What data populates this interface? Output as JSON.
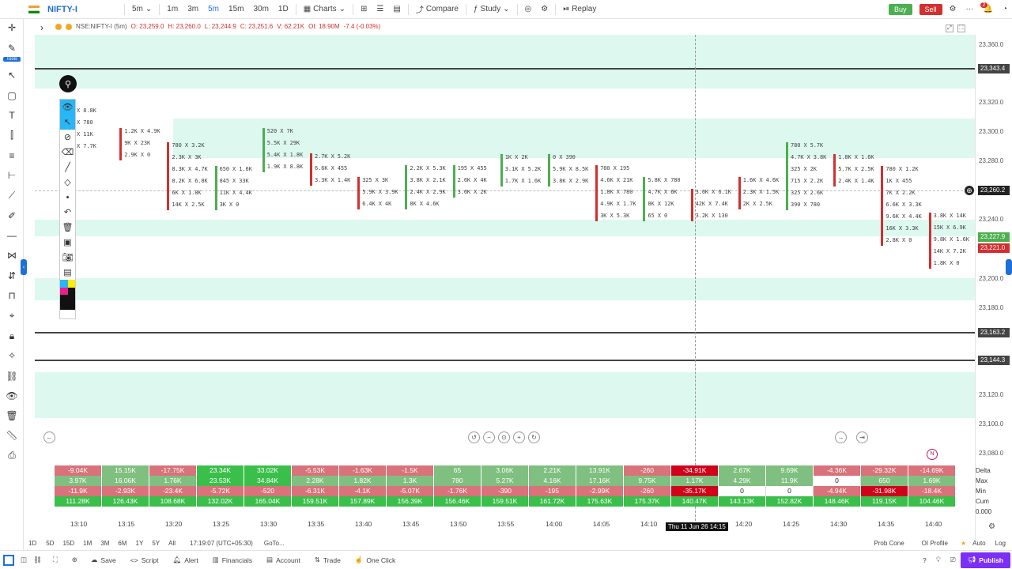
{
  "topbar": {
    "symbol": "NIFTY-I",
    "interval": "5m",
    "quick_intervals": [
      "1m",
      "3m",
      "5m",
      "15m",
      "30m",
      "1D"
    ],
    "active_interval": "5m",
    "charts_label": "Charts",
    "compare_label": "Compare",
    "study_label": "Study",
    "replay_label": "Replay",
    "buy_label": "Buy",
    "sell_label": "Sell",
    "notification_count": "2"
  },
  "left_toolbar": {
    "tools_label": "Tools",
    "icons": [
      "crosshair-icon",
      "pen-icon",
      "pointer-icon",
      "rectangle-icon",
      "text-icon",
      "fib-icon",
      "lines-icon",
      "hline-icon",
      "trendline-icon",
      "brush-icon",
      "ray-icon",
      "pattern-icon",
      "measure-icon",
      "zoom-icon",
      "magnet-icon",
      "lock-icon",
      "link-icon",
      "eye-icon",
      "trash-icon",
      "ruler-icon",
      "camera-icon"
    ]
  },
  "legend": {
    "symbol": "NSE:NIFTY-I (5m)",
    "o": "O: 23,259.0",
    "h": "H: 23,260.0",
    "l": "L: 23,244.9",
    "c": "C: 23,251.6",
    "v": "V: 62.21K",
    "oi": "OI: 18.90M",
    "chg": "-7.4  (-0.03%)"
  },
  "yaxis": {
    "labels": [
      "23,360.0",
      "23,320.0",
      "23,300.0",
      "23,280.0",
      "23,240.0",
      "23,200.0",
      "23,180.0",
      "23,120.0",
      "23,100.0",
      "23,080.0"
    ],
    "flags": [
      {
        "value": "23,343.4",
        "color": "#444444"
      },
      {
        "value": "23,260.2",
        "color": "#222222"
      },
      {
        "value": "23,227.9",
        "color": "#4caf50"
      },
      {
        "value": "23,221.0",
        "color": "#d32f2f"
      },
      {
        "value": "23,163.2",
        "color": "#444444"
      },
      {
        "value": "23,144.3",
        "color": "#444444"
      }
    ]
  },
  "footprint_columns": [
    {
      "time": "13:10",
      "rows": [
        "X 8.8K",
        "X 780",
        "X 11K",
        "X 7.7K"
      ]
    },
    {
      "time": "13:15",
      "rows": [
        "1.2K X 4.9K",
        "9K X 23K",
        "2.9K X 0"
      ]
    },
    {
      "time": "13:20",
      "rows": [
        "780 X 3.2K",
        "2.3K X 3K",
        "8.3K X 4.7K",
        "8.2K X 6.8K",
        "6K X 1.8K",
        "14K X 2.5K"
      ]
    },
    {
      "time": "13:25",
      "rows": [
        "650 X 1.6K",
        "845 X 33K",
        "11K X 4.4K",
        "3K X 0"
      ]
    },
    {
      "time": "13:30",
      "rows": [
        "520 X 7K",
        "5.5K X 29K",
        "5.4K X 1.8K",
        "1.9K X 8.8K"
      ]
    },
    {
      "time": "13:35",
      "rows": [
        "2.7K X 5.2K",
        "6.6K X 455",
        "3.3K X 1.4K"
      ]
    },
    {
      "time": "13:40",
      "rows": [
        "325 X 3K",
        "5.9K X 3.9K",
        "6.4K X 4K"
      ]
    },
    {
      "time": "13:45",
      "rows": [
        "2.2K X 5.3K",
        "3.8K X 2.1K",
        "2.4K X 2.9K",
        "8K X 4.6K"
      ]
    },
    {
      "time": "13:50",
      "rows": [
        "195 X 455",
        "2.6K X 4K",
        "3.6K X 2K"
      ]
    },
    {
      "time": "13:55",
      "rows": [
        "1K X 2K",
        "3.1K X 5.2K",
        "1.7K X 1.6K"
      ]
    },
    {
      "time": "14:00",
      "rows": [
        "0 X 390",
        "5.9K X 8.5K",
        "3.8K X 2.9K"
      ]
    },
    {
      "time": "14:05",
      "rows": [
        "780 X 195",
        "4.6K X 21K",
        "1.8K X 780",
        "4.9K X 1.7K",
        "3K X 5.3K"
      ]
    },
    {
      "time": "14:10",
      "rows": [
        "5.8K X 780",
        "4.7K X 6K",
        "8K X 12K",
        "65 X 0"
      ]
    },
    {
      "time": "14:15",
      "rows": [
        "3.6K X 6.1K",
        "42K X 7.4K",
        "3.2K X 130"
      ]
    },
    {
      "time": "14:20",
      "rows": [
        "1.6K X 4.6K",
        "2.3K X 1.5K",
        "2K X 2.5K"
      ]
    },
    {
      "time": "14:25",
      "rows": [
        "780 X 5.7K",
        "4.7K X 3.8K",
        "325 X 2K",
        "715 X 2.2K",
        "325 X 2.6K",
        "390 X 780"
      ]
    },
    {
      "time": "14:30",
      "rows": [
        "1.8K X 1.6K",
        "5.7K X 2.5K",
        "2.4K X 1.4K"
      ]
    },
    {
      "time": "14:35",
      "rows": [
        "780 X 1.2K",
        "1K X 455",
        "7K X 2.2K",
        "6.6K X 3.3K",
        "9.6K X 4.4K",
        "16K X 3.3K",
        "2.8K X 0"
      ]
    },
    {
      "time": "14:40",
      "rows": [
        "3.8K X 14K",
        "15K X 6.9K",
        "9.8K X 1.6K",
        "14K X 7.2K",
        "1.8K X 0"
      ]
    }
  ],
  "stats": {
    "row_labels": [
      "Delta",
      "Max",
      "Min",
      "Cum"
    ],
    "delta": [
      "-9.04K",
      "15.15K",
      "-17.75K",
      "23.34K",
      "33.02K",
      "-5.53K",
      "-1.63K",
      "-1.5K",
      "65",
      "3.06K",
      "2.21K",
      "13.91K",
      "-260",
      "-34.91K",
      "2.67K",
      "9.69K",
      "-4.36K",
      "-29.32K",
      "-14.69K"
    ],
    "max": [
      "3.97K",
      "16.06K",
      "1.76K",
      "23.53K",
      "34.84K",
      "2.28K",
      "1.82K",
      "1.3K",
      "780",
      "5.27K",
      "4.16K",
      "17.16K",
      "9.75K",
      "1.17K",
      "4.29K",
      "11.9K",
      "0",
      "650",
      "1.69K"
    ],
    "min": [
      "-11.9K",
      "-2.93K",
      "-23.4K",
      "-5.72K",
      "-520",
      "-6.31K",
      "-4.1K",
      "-5.07K",
      "-1.76K",
      "-390",
      "-195",
      "-2.99K",
      "-260",
      "-35.17K",
      "0",
      "0",
      "-4.94K",
      "-31.98K",
      "-18.4K"
    ],
    "cum": [
      "111.28K",
      "126.43K",
      "108.68K",
      "132.02K",
      "165.04K",
      "159.51K",
      "157.89K",
      "156.39K",
      "156.46K",
      "159.51K",
      "161.72K",
      "175.63K",
      "175.37K",
      "140.47K",
      "143.13K",
      "152.82K",
      "148.46K",
      "119.15K",
      "104.46K"
    ],
    "axis_value": "0.000"
  },
  "xaxis": {
    "labels": [
      "13:10",
      "13:15",
      "13:20",
      "13:25",
      "13:30",
      "13:35",
      "13:40",
      "13:45",
      "13:50",
      "13:55",
      "14:00",
      "14:05",
      "14:10",
      "14:20",
      "14:25",
      "14:30",
      "14:35",
      "14:40"
    ],
    "cursor_label": "Thu 11 Jun 26 14:15"
  },
  "footer": {
    "ranges": [
      "1D",
      "5D",
      "15D",
      "1M",
      "3M",
      "6M",
      "1Y",
      "5Y",
      "All"
    ],
    "clock": "17:19:07 (UTC+05:30)",
    "goto": "GoTo...",
    "prob_cone": "Prob Cone",
    "oi_profile": "OI Profile",
    "auto": "Auto",
    "log": "Log"
  },
  "bottombar": {
    "save": "Save",
    "script": "Script",
    "alert": "Alert",
    "financials": "Financials",
    "account": "Account",
    "trade": "Trade",
    "one_click": "One Click",
    "publish": "Publish"
  },
  "colors": {
    "zone": "#b4f0dc",
    "buy": "#4caf50",
    "sell": "#d32f2f",
    "accent": "#1e6fd9",
    "publish": "#7b2ff7"
  }
}
